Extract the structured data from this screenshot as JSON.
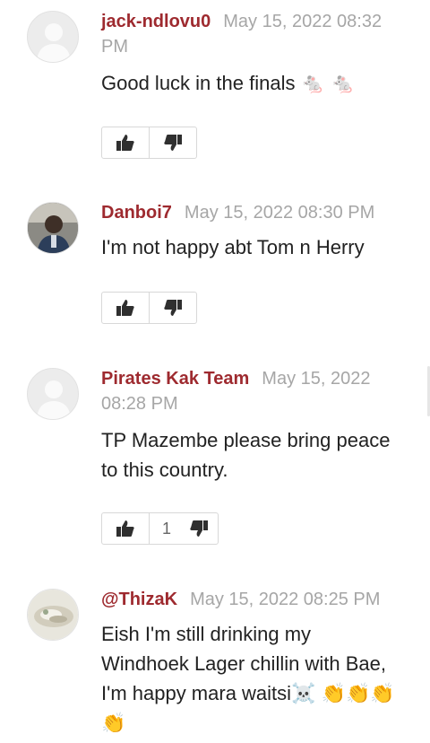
{
  "colors": {
    "author": "#9e2a2f",
    "timestamp": "#a6a6a6",
    "text": "#222222",
    "border": "#d8d8d8"
  },
  "comments": [
    {
      "author": "jack-ndlovu0",
      "time": "May 15, 2022 08:32 PM",
      "text": "Good luck in the finals 🐁 🐁",
      "avatar": "default-avatar",
      "dislikes": ""
    },
    {
      "author": "Danboi7",
      "time": "May 15, 2022 08:30 PM",
      "text": "I'm not happy abt Tom n Herry",
      "avatar": "photo-avatar",
      "dislikes": ""
    },
    {
      "author": "Pirates Kak Team",
      "time": "May 15, 2022 08:28 PM",
      "text": "TP Mazembe please bring peace to this country.",
      "avatar": "default-avatar",
      "dislikes": "1"
    },
    {
      "author": "@ThizaK",
      "time": "May 15, 2022 08:25 PM",
      "text": "Eish I'm still drinking my Windhoek Lager chillin with Bae, I'm happy mara waitsi☠️ 👏👏👏👏",
      "avatar": "photo-avatar",
      "dislikes": ""
    }
  ],
  "icons": {
    "like": "thumbs-up-icon",
    "dislike": "thumbs-down-icon"
  }
}
